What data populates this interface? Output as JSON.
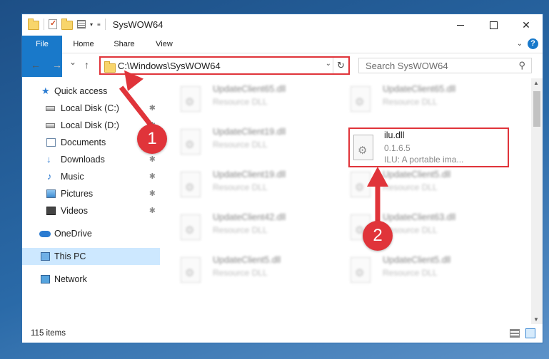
{
  "window": {
    "title": "SysWOW64",
    "controls": {
      "minimize": "",
      "maximize": "",
      "close": "✕"
    }
  },
  "ribbon": {
    "tabs": [
      {
        "label": "File",
        "active": true
      },
      {
        "label": "Home"
      },
      {
        "label": "Share"
      },
      {
        "label": "View"
      }
    ],
    "help_glyph": "?"
  },
  "nav": {
    "back": "←",
    "forward": "→",
    "recent": "⌄",
    "up": "↑",
    "address": "C:\\Windows\\SysWOW64",
    "search_placeholder": "Search SysWOW64"
  },
  "sidebar": {
    "items": [
      {
        "label": "Quick access",
        "icon": "star-icon"
      },
      {
        "label": "Local Disk (C:)",
        "icon": "drive-icon",
        "pinned": true
      },
      {
        "label": "Local Disk (D:)",
        "icon": "drive-icon",
        "pinned": true
      },
      {
        "label": "Documents",
        "icon": "documents-icon",
        "pinned": true
      },
      {
        "label": "Downloads",
        "icon": "download-icon",
        "pinned": true
      },
      {
        "label": "Music",
        "icon": "music-icon",
        "pinned": true
      },
      {
        "label": "Pictures",
        "icon": "pictures-icon",
        "pinned": true
      },
      {
        "label": "Videos",
        "icon": "video-icon",
        "pinned": true
      },
      {
        "label": "OneDrive",
        "icon": "cloud-icon"
      },
      {
        "label": "This PC",
        "icon": "computer-icon",
        "selected": true
      },
      {
        "label": "Network",
        "icon": "network-icon"
      }
    ],
    "pin_glyph": "📌"
  },
  "files": [
    {
      "name": "UpdateClient65.dll",
      "desc": "Resource DLL"
    },
    {
      "name": "UpdateClient65.dll",
      "desc": "Resource DLL"
    },
    {
      "name": "UpdateClient19.dll",
      "desc": "Resource DLL"
    },
    {
      "name": "UpdateClient19.dll",
      "desc": "Resource DLL"
    },
    {
      "name": "UpdateClient5.dll",
      "desc": "Resource DLL"
    },
    {
      "name": "UpdateClient42.dll",
      "desc": "Resource DLL"
    },
    {
      "name": "UpdateClient63.dll",
      "desc": "Resource DLL"
    },
    {
      "name": "UpdateClient5.dll",
      "desc": "Resource DLL"
    },
    {
      "name": "UpdateClient5.dll",
      "desc": "Resource DLL"
    }
  ],
  "highlighted_file": {
    "name": "ilu.dll",
    "version": "0.1.6.5",
    "description": "ILU: A portable ima..."
  },
  "status": {
    "item_count": "115 items"
  },
  "annotations": {
    "step1": "1",
    "step2": "2",
    "color": "#e0343a"
  }
}
